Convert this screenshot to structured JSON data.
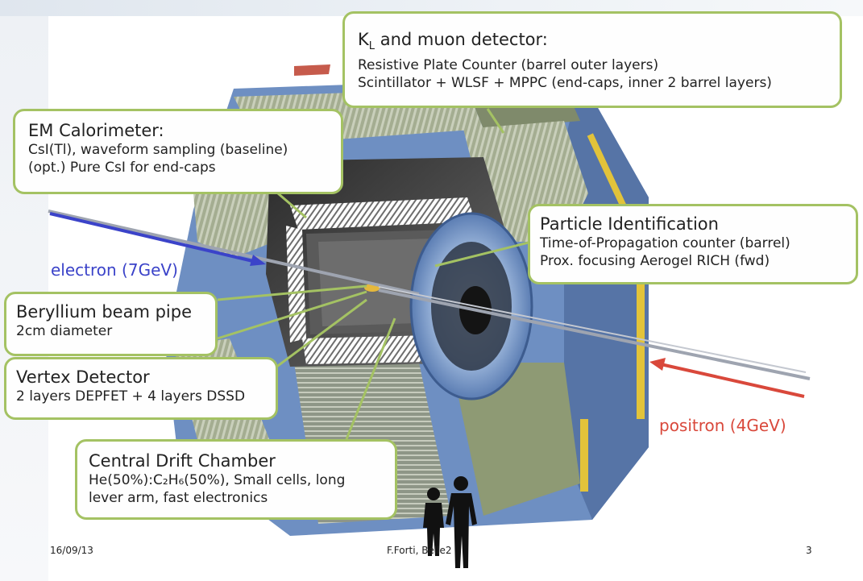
{
  "callouts": {
    "kl": {
      "title_main": "K",
      "title_sub": "L",
      "title_rest": " and muon detector:",
      "lines": [
        "Resistive Plate Counter (barrel outer layers)",
        "Scintillator + WLSF + MPPC (end-caps, inner 2 barrel layers)"
      ]
    },
    "em": {
      "title": "EM Calorimeter:",
      "lines": [
        "CsI(Tl), waveform sampling (baseline)",
        "(opt.) Pure CsI for end-caps"
      ]
    },
    "pid": {
      "title": "Particle Identification",
      "lines": [
        "Time-of-Propagation counter (barrel)",
        "Prox. focusing Aerogel RICH (fwd)"
      ]
    },
    "beampipe": {
      "title": "Beryllium beam pipe",
      "lines": [
        "2cm diameter"
      ]
    },
    "vertex": {
      "title": "Vertex Detector",
      "lines": [
        "2 layers DEPFET + 4 layers DSSD"
      ]
    },
    "cdc": {
      "title": "Central Drift Chamber",
      "lines": [
        "He(50%):C₂H₆(50%), Small cells, long",
        "lever arm,  fast electronics"
      ]
    }
  },
  "beams": {
    "electron": "electron  (7GeV)",
    "positron": "positron (4GeV)"
  },
  "footer": {
    "date": "16/09/13",
    "author": "F.Forti, Belle2",
    "page": "3"
  },
  "colors": {
    "callout_border": "#a4c263",
    "electron": "#3b43c9",
    "positron": "#d9483b",
    "yoke_blue": "#6e8fc2",
    "yoke_green": "#8f9b77"
  }
}
